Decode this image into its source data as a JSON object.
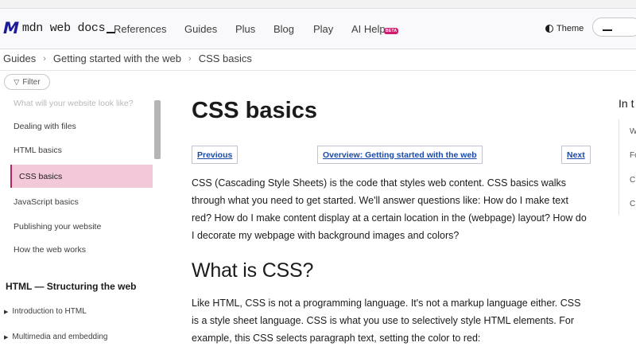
{
  "header": {
    "logo_text": "mdn web docs",
    "nav": [
      "References",
      "Guides",
      "Plus",
      "Blog",
      "Play",
      "AI Help"
    ],
    "ai_badge": "BETA",
    "theme_label": "Theme",
    "search_value": ""
  },
  "breadcrumbs": [
    "Guides",
    "Getting started with the web",
    "CSS basics"
  ],
  "sidebar": {
    "filter_label": "Filter",
    "items": [
      "What will your website look like?",
      "Dealing with files",
      "HTML basics",
      "CSS basics",
      "JavaScript basics",
      "Publishing your website",
      "How the web works"
    ],
    "section": "HTML — Structuring the web",
    "subitems": [
      "Introduction to HTML",
      "Multimedia and embedding"
    ]
  },
  "main": {
    "title": "CSS basics",
    "prev": "Previous",
    "overview": "Overview: Getting started with the web",
    "next": "Next",
    "intro": "CSS (Cascading Style Sheets) is the code that styles web content. CSS basics walks through what you need to get started. We'll answer questions like: How do I make text red? How do I make content display at a certain location in the (webpage) layout? How do I decorate my webpage with background images and colors?",
    "h2": "What is CSS?",
    "para2": "Like HTML, CSS is not a programming language. It's not a markup language either. CSS is a style sheet language. CSS is what you use to selectively style HTML elements. For example, this CSS selects paragraph text, setting the color to red:"
  },
  "toc": {
    "heading": "In t",
    "items": [
      "W",
      "Fo",
      "C",
      "C"
    ]
  },
  "colors": {
    "accent": "#b4235d",
    "active_bg": "#f3c9d9",
    "link": "#1a4aa8"
  }
}
